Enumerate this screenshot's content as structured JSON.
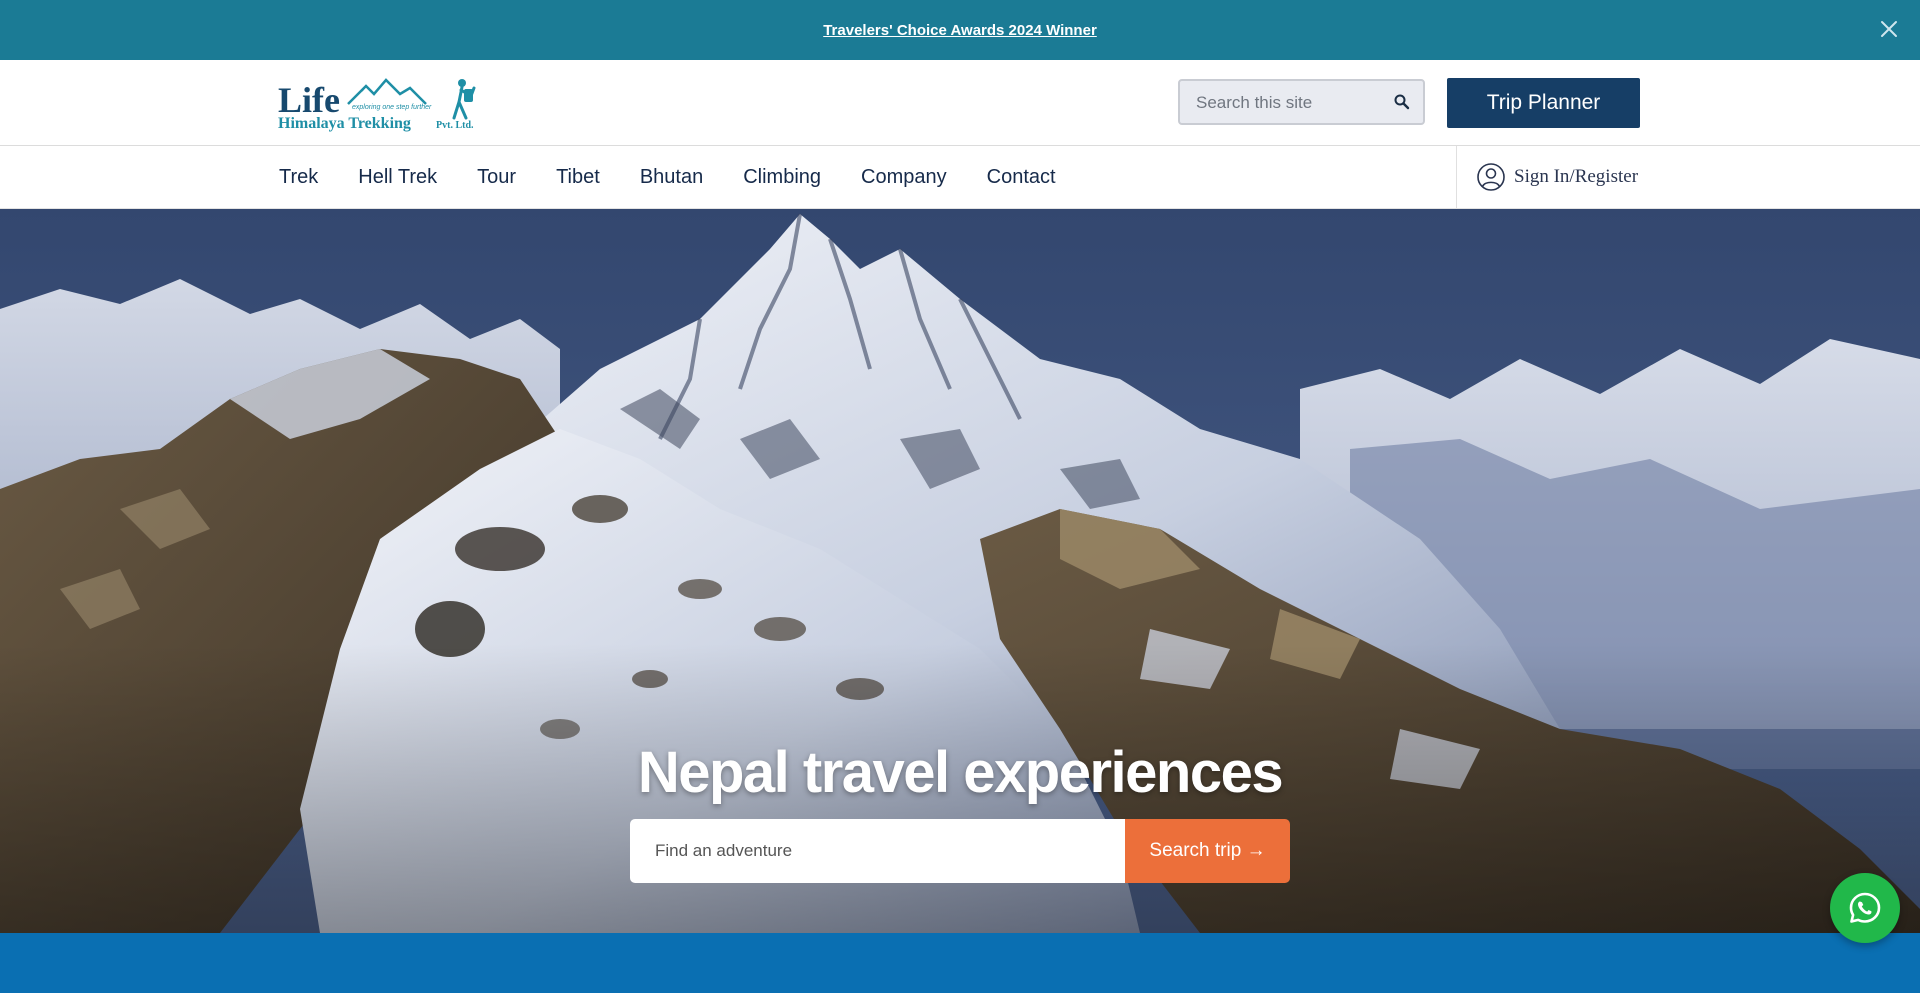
{
  "announcement": {
    "text": "Travelers' Choice Awards 2024 Winner",
    "close_icon": "close-icon"
  },
  "header": {
    "logo": {
      "brand_word": "Life",
      "tagline": "exploring one step further",
      "company": "Himalaya Trekking",
      "suffix": "Pvt. Ltd."
    },
    "search": {
      "placeholder": "Search this site",
      "icon": "search-icon"
    },
    "trip_planner_label": "Trip Planner"
  },
  "nav": {
    "items": [
      {
        "label": "Trek"
      },
      {
        "label": "Hell Trek"
      },
      {
        "label": "Tour"
      },
      {
        "label": "Tibet"
      },
      {
        "label": "Bhutan"
      },
      {
        "label": "Climbing"
      },
      {
        "label": "Company"
      },
      {
        "label": "Contact"
      }
    ],
    "signin": {
      "label": "Sign In/Register",
      "icon": "user-icon"
    }
  },
  "hero": {
    "title": "Nepal travel experiences",
    "search_placeholder": "Find an adventure",
    "search_button": "Search trip →"
  },
  "colors": {
    "announcement_bg": "#1b7b95",
    "primary_dark": "#163e66",
    "accent_orange": "#ec6f3a",
    "footer_blue": "#0a6fb2",
    "whatsapp_green": "#21b84a"
  },
  "floating": {
    "whatsapp_icon": "whatsapp-icon"
  }
}
